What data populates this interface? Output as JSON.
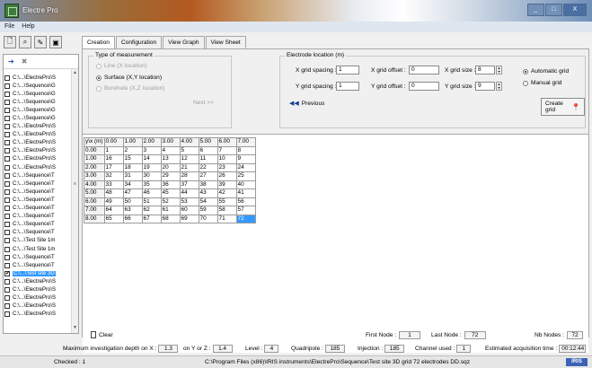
{
  "window": {
    "title": "Electre Pro",
    "controls": [
      "_",
      "□",
      "X"
    ]
  },
  "menu": {
    "items": [
      "File",
      "Help"
    ]
  },
  "toolbar": {
    "icons": [
      "new-file-icon",
      "search-icon",
      "write-icon",
      "save-icon"
    ]
  },
  "left_panel": {
    "tool_icons": [
      "add-icon",
      "delete-icon"
    ],
    "files": [
      {
        "name": "C:\\...\\ElectrePro\\S",
        "checked": false
      },
      {
        "name": "C:\\...\\Sequence\\G",
        "checked": false
      },
      {
        "name": "C:\\...\\Sequence\\G",
        "checked": false
      },
      {
        "name": "C:\\...\\Sequence\\G",
        "checked": false
      },
      {
        "name": "C:\\...\\Sequence\\G",
        "checked": false
      },
      {
        "name": "C:\\...\\Sequence\\G",
        "checked": false
      },
      {
        "name": "C:\\...\\ElectrePro\\S",
        "checked": false
      },
      {
        "name": "C:\\...\\ElectrePro\\S",
        "checked": false
      },
      {
        "name": "C:\\...\\ElectrePro\\S",
        "checked": false
      },
      {
        "name": "C:\\...\\ElectrePro\\S",
        "checked": false
      },
      {
        "name": "C:\\...\\ElectrePro\\S",
        "checked": false
      },
      {
        "name": "C:\\...\\ElectrePro\\S",
        "checked": false
      },
      {
        "name": "C:\\...\\Sequence\\T",
        "checked": false
      },
      {
        "name": "C:\\...\\Sequence\\T",
        "checked": false
      },
      {
        "name": "C:\\...\\Sequence\\T",
        "checked": false
      },
      {
        "name": "C:\\...\\Sequence\\T",
        "checked": false
      },
      {
        "name": "C:\\...\\Sequence\\T",
        "checked": false
      },
      {
        "name": "C:\\...\\Sequence\\T",
        "checked": false
      },
      {
        "name": "C:\\...\\Sequence\\T",
        "checked": false
      },
      {
        "name": "C:\\...\\Sequence\\T",
        "checked": false
      },
      {
        "name": "C:\\...\\Test Site 1m",
        "checked": false
      },
      {
        "name": "C:\\...\\Test Site 1m",
        "checked": false
      },
      {
        "name": "C:\\...\\Sequence\\T",
        "checked": false
      },
      {
        "name": "C:\\...\\Sequence\\T",
        "checked": false
      },
      {
        "name": "C:\\...\\Test site 3D",
        "checked": true,
        "selected": true
      },
      {
        "name": "C:\\...\\ElectrePro\\S",
        "checked": false
      },
      {
        "name": "C:\\...\\ElectrePro\\S",
        "checked": false
      },
      {
        "name": "C:\\...\\ElectrePro\\S",
        "checked": false
      },
      {
        "name": "C:\\...\\ElectrePro\\S",
        "checked": false
      },
      {
        "name": "C:\\...\\ElectrePro\\S",
        "checked": false
      }
    ]
  },
  "tabs": [
    "Creation",
    "Configuration",
    "View Graph",
    "View Sheet"
  ],
  "measurement": {
    "legend": "Type of measurement",
    "options": [
      {
        "label": "Line (X location)",
        "selected": false,
        "enabled": false
      },
      {
        "label": "Surface (X,Y location)",
        "selected": true,
        "enabled": true
      },
      {
        "label": "Borehole (X,Z location)",
        "selected": false,
        "enabled": false
      }
    ],
    "next_label": "Next >>"
  },
  "electrode": {
    "legend": "Electrode location (m)",
    "x_spacing_label": "X grid spacing :",
    "x_spacing": "1",
    "x_offset_label": "X grid offset :",
    "x_offset": "0",
    "x_size_label": "X grid size :",
    "x_size": "8",
    "y_spacing_label": "Y grid spacing :",
    "y_spacing": "1",
    "y_offset_label": "Y grid offset :",
    "y_offset": "0",
    "y_size_label": "Y grid size :",
    "y_size": "9",
    "automatic_label": "Automatic grid",
    "manual_label": "Manual grid",
    "previous_label": "Previous",
    "create_label": "Create grid"
  },
  "grid": {
    "header": [
      "y\\x (m)",
      "0.00",
      "1.00",
      "2.00",
      "3.00",
      "4.00",
      "5.00",
      "6.00",
      "7.00"
    ],
    "rows": [
      [
        "0.00",
        "1",
        "2",
        "3",
        "4",
        "5",
        "6",
        "7",
        "8"
      ],
      [
        "1.00",
        "16",
        "15",
        "14",
        "13",
        "12",
        "11",
        "10",
        "9"
      ],
      [
        "2.00",
        "17",
        "18",
        "19",
        "20",
        "21",
        "22",
        "23",
        "24"
      ],
      [
        "3.00",
        "32",
        "31",
        "30",
        "29",
        "28",
        "27",
        "26",
        "25"
      ],
      [
        "4.00",
        "33",
        "34",
        "35",
        "36",
        "37",
        "38",
        "39",
        "40"
      ],
      [
        "5.00",
        "48",
        "47",
        "46",
        "45",
        "44",
        "43",
        "42",
        "41"
      ],
      [
        "6.00",
        "49",
        "50",
        "51",
        "52",
        "53",
        "54",
        "55",
        "56"
      ],
      [
        "7.00",
        "64",
        "63",
        "62",
        "61",
        "60",
        "59",
        "58",
        "57"
      ],
      [
        "8.00",
        "65",
        "66",
        "67",
        "68",
        "69",
        "70",
        "71",
        "72"
      ]
    ]
  },
  "bottom": {
    "clear_label": "Clear",
    "first_node_label": "First Node :",
    "first_node": "1",
    "last_node_label": "Last Node :",
    "last_node": "72",
    "nb_nodes_label": "Nb Nodes :",
    "nb_nodes": "72"
  },
  "status": {
    "max_depth_label": "Maximum investigation depth on X :",
    "max_depth_x": "1.3",
    "on_yz_label": "on Y or Z :",
    "max_depth_yz": "1.4",
    "level_label": "Level :",
    "level": "4",
    "quadripole_label": "Quadripole :",
    "quadripole": "185",
    "injection_label": "Injection :",
    "injection": "185",
    "channel_label": "Channel used :",
    "channel": "1",
    "acq_time_label": "Estimated acquisition time :",
    "acq_time": "00:12:44"
  },
  "footer": {
    "checked": "Checked : 1",
    "path": "C:\\Program Files (x86)\\IRIS instruments\\ElectrePro\\Sequence\\Test site 3D grid 72 electrodes DD.sqz",
    "logo": "IRIS"
  }
}
